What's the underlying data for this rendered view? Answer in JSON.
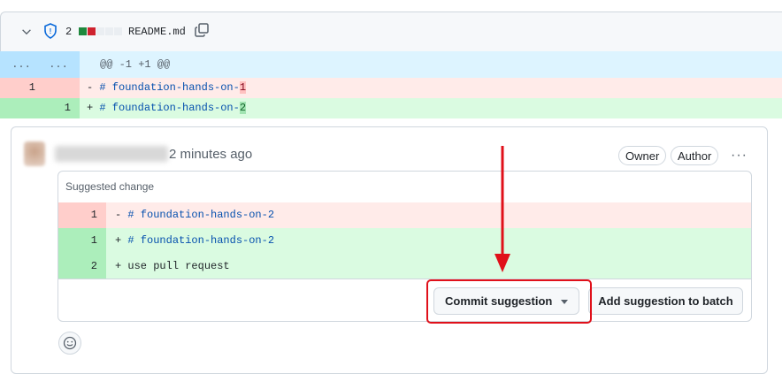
{
  "file": {
    "changes_count": "2",
    "filename": "README.md"
  },
  "diff": {
    "hunk": {
      "left": "...",
      "right": "...",
      "header": "@@ -1 +1 @@"
    },
    "deleted": {
      "line": "1",
      "prefix": "- ",
      "keyword": "# foundation-hands-on-",
      "changed": "1"
    },
    "added": {
      "line": "1",
      "prefix": "+ ",
      "keyword": "# foundation-hands-on-",
      "changed": "2"
    }
  },
  "comment": {
    "time": "2 minutes ago",
    "badges": [
      "Owner",
      "Author"
    ],
    "menu": "···"
  },
  "suggestion": {
    "title": "Suggested change",
    "rows": [
      {
        "num": "1",
        "sign": "- ",
        "kw": "# foundation-hands-on-2",
        "rest": ""
      },
      {
        "num": "1",
        "sign": "+ ",
        "kw": "# foundation-hands-on-2",
        "rest": ""
      },
      {
        "num": "2",
        "sign": "+ ",
        "kw": "",
        "rest": "use pull request"
      }
    ]
  },
  "buttons": {
    "commit": "Commit suggestion",
    "batch": "Add suggestion to batch"
  },
  "colors": {
    "annotation": "#e0101a",
    "deletion_bg": "#ffebe9",
    "addition_bg": "#dafbe1",
    "hunk_bg": "#ddf4ff"
  }
}
